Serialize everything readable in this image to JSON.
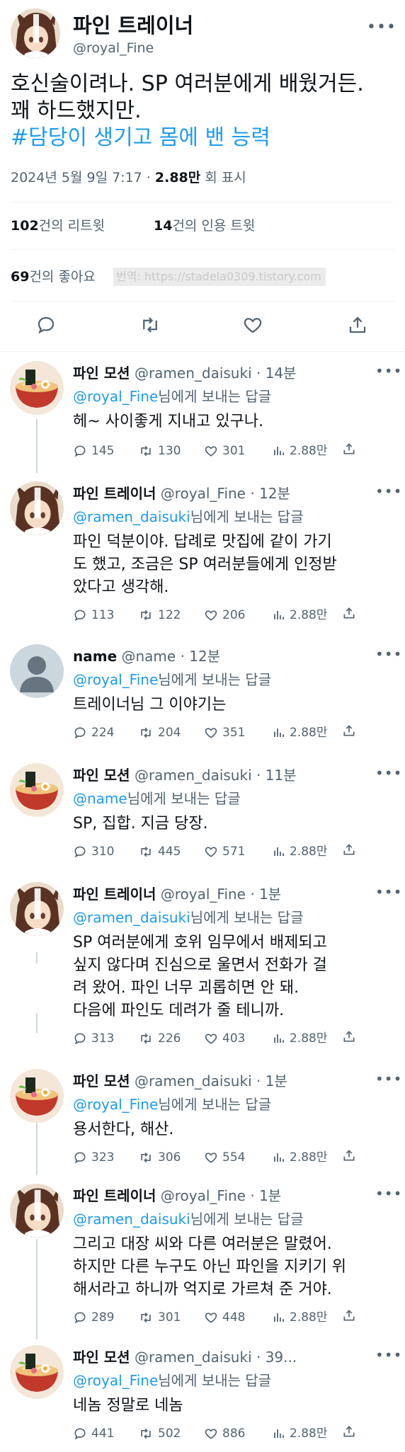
{
  "colors": {
    "accent": "#1d9bf0",
    "muted": "#536471",
    "text": "#0f1419"
  },
  "main_tweet": {
    "display_name": "파인 트레이너",
    "handle": "@royal_Fine",
    "text": "호신술이려나. SP 여러분에게 배웠거든.\n꽤 하드했지만.",
    "hashtag": "#담당이 생기고 몸에 밴 능력",
    "date": "2024년 5월 9일 7:17 · ",
    "views": "2.88만",
    "views_suffix": " 회 표시",
    "retweets_count": "102",
    "retweets_label": "건의 리트윗",
    "quotes_count": "14",
    "quotes_label": "건의 인용 트윗",
    "likes_count": "69",
    "likes_label": "건의 좋아요",
    "watermark": "번역: https://stadela0309.tistory.com"
  },
  "replies": [
    {
      "name": "파인 모션",
      "handle": "@ramen_daisuki",
      "time": " · 14분",
      "reply_to": "@royal_Fine",
      "reply_suffix": "님에게 보내는 답글",
      "text": "헤~ 사이좋게 지내고 있구나.",
      "replies": "145",
      "retweets": "130",
      "likes": "301",
      "views": "2.88만",
      "avatar": "ramen"
    },
    {
      "name": "파인 트레이너",
      "handle": "@royal_Fine",
      "time": " · 12분",
      "reply_to": "@ramen_daisuki",
      "reply_suffix": "님에게 보내는 답글",
      "text": "파인 덕분이야. 답례로 맛집에 같이 가기\n도 했고, 조금은 SP 여러분들에게 인정받\n았다고 생각해.",
      "replies": "113",
      "retweets": "122",
      "likes": "206",
      "views": "2.88만",
      "avatar": "trainer"
    },
    {
      "name": "name",
      "handle": "@name",
      "time": " · 12분",
      "reply_to": "@royal_Fine",
      "reply_suffix": "님에게 보내는 답글",
      "text": "트레이너님 그 이야기는",
      "replies": "224",
      "retweets": "204",
      "likes": "351",
      "views": "2.88만",
      "avatar": "default"
    },
    {
      "name": "파인 모션",
      "handle": "@ramen_daisuki",
      "time": " · 11분",
      "reply_to": "@name",
      "reply_suffix": "님에게 보내는 답글",
      "text": "SP, 집합. 지금 당장.",
      "replies": "310",
      "retweets": "445",
      "likes": "571",
      "views": "2.88만",
      "avatar": "ramen"
    },
    {
      "name": "파인 트레이너",
      "handle": "@royal_Fine",
      "time": " · 1분",
      "reply_to": "@ramen_daisuki",
      "reply_suffix": "님에게 보내는 답글",
      "text": "SP 여러분에게 호위 임무에서 배제되고\n싶지 않다며 진심으로 울면서 전화가 걸\n려 왔어. 파인 너무 괴롭히면 안 돼.\n다음에 파인도 데려가 줄 테니까.",
      "replies": "313",
      "retweets": "226",
      "likes": "403",
      "views": "2.88만",
      "avatar": "trainer"
    },
    {
      "name": "파인 모션",
      "handle": "@ramen_daisuki",
      "time": " · 1분",
      "reply_to": "@royal_Fine",
      "reply_suffix": "님에게 보내는 답글",
      "text": "용서한다, 해산.",
      "replies": "323",
      "retweets": "306",
      "likes": "554",
      "views": "2.88만",
      "avatar": "ramen"
    },
    {
      "name": "파인 트레이너",
      "handle": "@royal_Fine",
      "time": " · 1분",
      "reply_to": "@ramen_daisuki",
      "reply_suffix": "님에게 보내는 답글",
      "text": "그리고 대장 씨와 다른 여러분은 말렸어.\n하지만 다른 누구도 아닌 파인을 지키기 위\n해서라고 하니까 억지로 가르쳐 준 거야.",
      "replies": "289",
      "retweets": "301",
      "likes": "448",
      "views": "2.88만",
      "avatar": "trainer"
    },
    {
      "name": "파인 모션",
      "handle": "@ramen_daisuki",
      "time": " · 39...",
      "reply_to": "@royal_Fine",
      "reply_suffix": "님에게 보내는 답글",
      "text": "네놈 정말로 네놈",
      "replies": "441",
      "retweets": "502",
      "likes": "886",
      "views": "2.88만",
      "avatar": "ramen"
    }
  ]
}
